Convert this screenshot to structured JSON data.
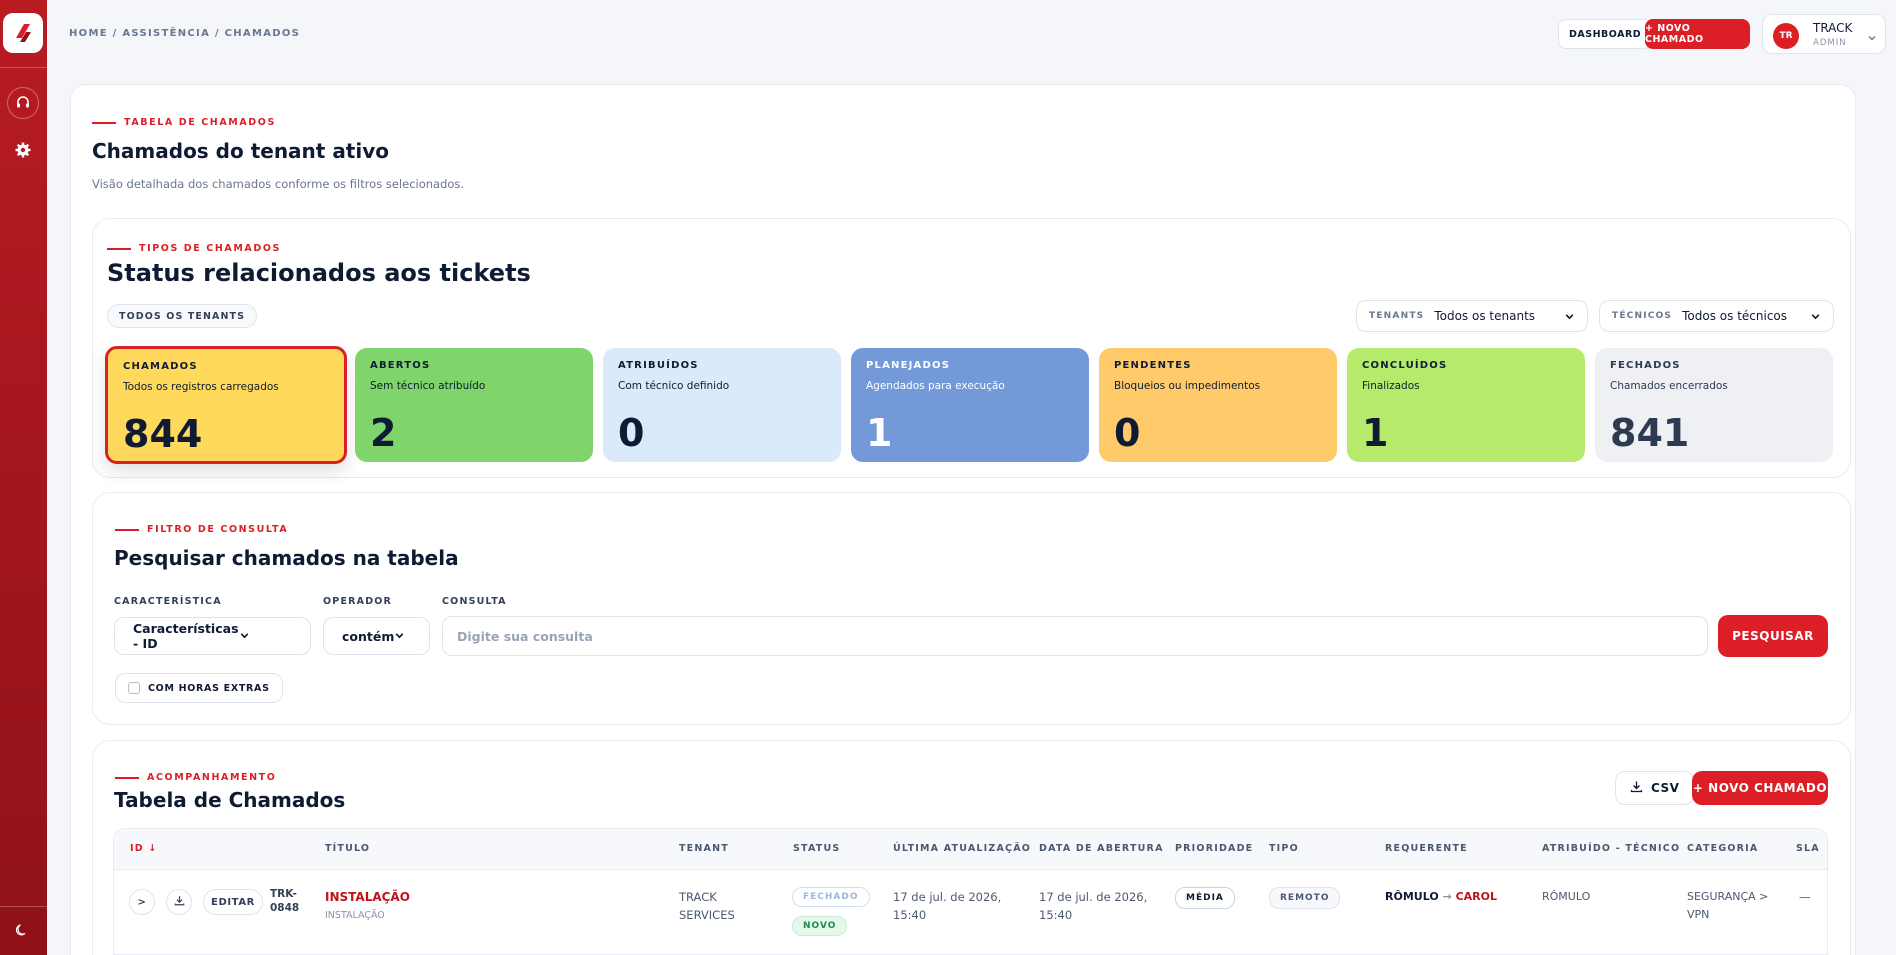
{
  "breadcrumb": "HOME / ASSISTÊNCIA / CHAMADOS",
  "topbar": {
    "dashboard_label": "DASHBOARD",
    "new_ticket_label": "+ NOVO CHAMADO",
    "user": {
      "initials": "TR",
      "name": "TRACK",
      "role": "ADMIN"
    }
  },
  "page": {
    "kicker": "TABELA DE CHAMADOS",
    "title": "Chamados do tenant ativo",
    "subtitle": "Visão detalhada dos chamados conforme os filtros selecionados."
  },
  "status_section": {
    "kicker": "TIPOS DE CHAMADOS",
    "title": "Status relacionados aos tickets",
    "tenant_pill": "TODOS OS TENANTS",
    "tenants_filter": {
      "label": "TENANTS",
      "value": "Todos os tenants"
    },
    "tech_filter": {
      "label": "TÉCNICOS",
      "value": "Todos os técnicos"
    },
    "cards": [
      {
        "title": "CHAMADOS",
        "desc": "Todos os registros carregados",
        "count": "844",
        "bg": "#ffd95c",
        "fg": "#0f1b33",
        "selected": true
      },
      {
        "title": "ABERTOS",
        "desc": "Sem técnico atribuído",
        "count": "2",
        "bg": "#7fd46c",
        "fg": "#0f1b33"
      },
      {
        "title": "ATRIBUÍDOS",
        "desc": "Com técnico definido",
        "count": "0",
        "bg": "#dbeafb",
        "fg": "#0f1b33"
      },
      {
        "title": "PLANEJADOS",
        "desc": "Agendados para execução",
        "count": "1",
        "bg": "#7499d8",
        "fg": "#ffffff"
      },
      {
        "title": "PENDENTES",
        "desc": "Bloqueios ou impedimentos",
        "count": "0",
        "bg": "#ffca6a",
        "fg": "#0f1b33"
      },
      {
        "title": "CONCLUÍDOS",
        "desc": "Finalizados",
        "count": "1",
        "bg": "#b5ea6b",
        "fg": "#0f1b33"
      },
      {
        "title": "FECHADOS",
        "desc": "Chamados encerrados",
        "count": "841",
        "bg": "#eef0f3",
        "fg": "#2e3a52"
      }
    ]
  },
  "filter_section": {
    "kicker": "FILTRO DE CONSULTA",
    "title": "Pesquisar chamados na tabela",
    "char_label": "CARACTERÍSTICA",
    "char_value": "Características - ID",
    "op_label": "OPERADOR",
    "op_value": "contém",
    "query_label": "CONSULTA",
    "query_placeholder": "Digite sua consulta",
    "search_label": "PESQUISAR",
    "overtime_label": "COM HORAS EXTRAS"
  },
  "table_section": {
    "kicker": "ACOMPANHAMENTO",
    "title": "Tabela de Chamados",
    "csv_label": "CSV",
    "new_label": "+ NOVO CHAMADO",
    "columns": [
      "ID ↓",
      "TÍTULO",
      "TENANT",
      "STATUS",
      "ÚLTIMA ATUALIZAÇÃO",
      "DATA DE ABERTURA",
      "PRIORIDADE",
      "TIPO",
      "REQUERENTE",
      "ATRIBUÍDO - TÉCNICO",
      "CATEGORIA",
      "SLA"
    ],
    "rows": [
      {
        "expand": ">",
        "edit": "EDITAR",
        "id_line1": "TRK-",
        "id_line2": "0848",
        "title": "INSTALAÇÃO",
        "title_sub": "INSTALAÇÃO",
        "tenant_line1": "TRACK",
        "tenant_line2": "SERVICES",
        "status_1": "FECHADO",
        "status_2": "NOVO",
        "updated_line1": "17 de jul. de 2026,",
        "updated_line2": "15:40",
        "opened_line1": "17 de jul. de 2026,",
        "opened_line2": "15:40",
        "priority": "MÉDIA",
        "type": "REMOTO",
        "requester": "RÔMULO",
        "requester_to": "CAROL",
        "assigned": "RÔMULO",
        "category_line1": "SEGURANÇA >",
        "category_line2": "VPN",
        "sla": "—"
      }
    ]
  }
}
